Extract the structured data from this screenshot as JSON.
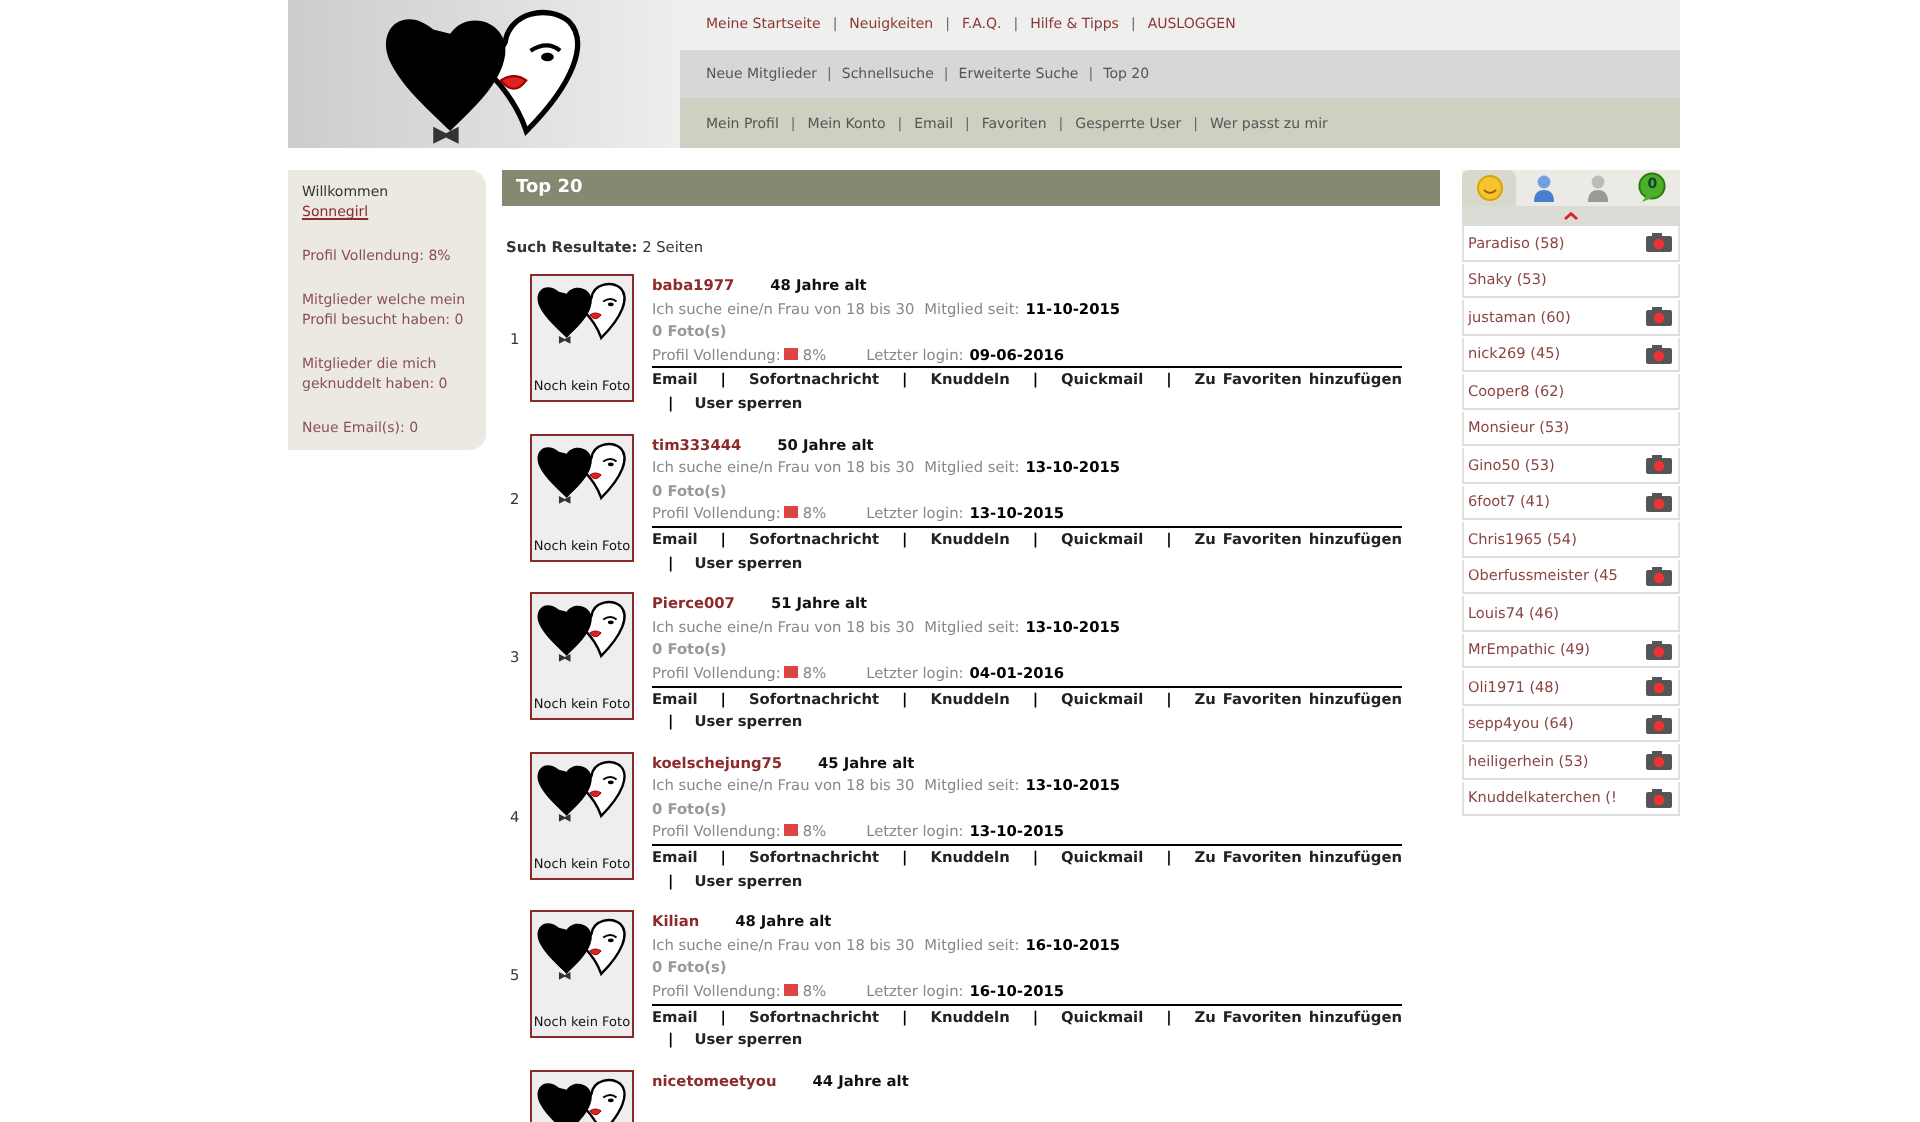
{
  "separator": "|",
  "header": {
    "nav_top": [
      "Meine Startseite",
      "Neuigkeiten",
      "F.A.Q.",
      "Hilfe & Tipps",
      "AUSLOGGEN"
    ],
    "nav_middle": [
      "Neue Mitglieder",
      "Schnellsuche",
      "Erweiterte Suche",
      "Top 20"
    ],
    "nav_bottom": [
      "Mein Profil",
      "Mein Konto",
      "Email",
      "Favoriten",
      "Gesperrte User",
      "Wer passt zu mir"
    ]
  },
  "left_panel": {
    "greeting": "Willkommen",
    "username": "Sonnegirl",
    "stats": [
      "Profil Vollendung: 8%",
      "Mitglieder welche mein Profil besucht haben: 0",
      "Mitglieder die mich geknuddelt haben: 0",
      "Neue Email(s): 0"
    ]
  },
  "main": {
    "title": "Top 20",
    "results_label": "Such Resultate:",
    "results_value": "2 Seiten",
    "results": [
      {
        "rank": "1",
        "name": "baba1977",
        "age": "48 Jahre alt",
        "search": "Ich suche eine/n Frau von 18 bis 30",
        "since_label": "Mitglied seit:",
        "since": "11-10-2015",
        "photos": "0 Foto(s)",
        "photo_text": "Noch kein Foto",
        "completion_label": "Profil Vollendung:",
        "completion": "8%",
        "login_label": "Letzter login:",
        "login": "09-06-2016",
        "actions": [
          "Email",
          "Sofortnachricht",
          "Knuddeln",
          "Quickmail",
          "Zu Favoriten hinzufügen",
          "User sperren"
        ]
      },
      {
        "rank": "2",
        "name": "tim333444",
        "age": "50 Jahre alt",
        "search": "Ich suche eine/n Frau von 18 bis 30",
        "since_label": "Mitglied seit:",
        "since": "13-10-2015",
        "photos": "0 Foto(s)",
        "photo_text": "Noch kein Foto",
        "completion_label": "Profil Vollendung:",
        "completion": "8%",
        "login_label": "Letzter login:",
        "login": "13-10-2015",
        "actions": [
          "Email",
          "Sofortnachricht",
          "Knuddeln",
          "Quickmail",
          "Zu Favoriten hinzufügen",
          "User sperren"
        ]
      },
      {
        "rank": "3",
        "name": "Pierce007",
        "age": "51 Jahre alt",
        "search": "Ich suche eine/n Frau von 18 bis 30",
        "since_label": "Mitglied seit:",
        "since": "13-10-2015",
        "photos": "0 Foto(s)",
        "photo_text": "Noch kein Foto",
        "completion_label": "Profil Vollendung:",
        "completion": "8%",
        "login_label": "Letzter login:",
        "login": "04-01-2016",
        "actions": [
          "Email",
          "Sofortnachricht",
          "Knuddeln",
          "Quickmail",
          "Zu Favoriten hinzufügen",
          "User sperren"
        ]
      },
      {
        "rank": "4",
        "name": "koelschejung75",
        "age": "45 Jahre alt",
        "search": "Ich suche eine/n Frau von 18 bis 30",
        "since_label": "Mitglied seit:",
        "since": "13-10-2015",
        "photos": "0 Foto(s)",
        "photo_text": "Noch kein Foto",
        "completion_label": "Profil Vollendung:",
        "completion": "8%",
        "login_label": "Letzter login:",
        "login": "13-10-2015",
        "actions": [
          "Email",
          "Sofortnachricht",
          "Knuddeln",
          "Quickmail",
          "Zu Favoriten hinzufügen",
          "User sperren"
        ]
      },
      {
        "rank": "5",
        "name": "Kilian",
        "age": "48 Jahre alt",
        "search": "Ich suche eine/n Frau von 18 bis 30",
        "since_label": "Mitglied seit:",
        "since": "16-10-2015",
        "photos": "0 Foto(s)",
        "photo_text": "Noch kein Foto",
        "completion_label": "Profil Vollendung:",
        "completion": "8%",
        "login_label": "Letzter login:",
        "login": "16-10-2015",
        "actions": [
          "Email",
          "Sofortnachricht",
          "Knuddeln",
          "Quickmail",
          "Zu Favoriten hinzufügen",
          "User sperren"
        ]
      },
      {
        "name": "nicetomeetyou",
        "age": "44 Jahre alt"
      }
    ]
  },
  "online": {
    "tabs": [
      {
        "kind": "smiley",
        "selected": true
      },
      {
        "kind": "user-blue",
        "selected": false
      },
      {
        "kind": "user-grey",
        "selected": false
      },
      {
        "kind": "chat",
        "badge": "0",
        "selected": false
      }
    ],
    "users": [
      {
        "label": "Paradiso (58)",
        "webcam": true
      },
      {
        "label": "Shaky (53)",
        "webcam": false
      },
      {
        "label": "justaman (60)",
        "webcam": true
      },
      {
        "label": "nick269 (45)",
        "webcam": true
      },
      {
        "label": "Cooper8 (62)",
        "webcam": false
      },
      {
        "label": "Monsieur (53)",
        "webcam": false
      },
      {
        "label": "Gino50 (53)",
        "webcam": true
      },
      {
        "label": "6foot7 (41)",
        "webcam": true
      },
      {
        "label": "Chris1965 (54)",
        "webcam": false
      },
      {
        "label": "Oberfussmeister (45",
        "webcam": true
      },
      {
        "label": "Louis74 (46)",
        "webcam": false
      },
      {
        "label": "MrEmpathic (49)",
        "webcam": true
      },
      {
        "label": "Oli1971 (48)",
        "webcam": true
      },
      {
        "label": "sepp4you (64)",
        "webcam": true
      },
      {
        "label": "heiligerhein (53)",
        "webcam": true
      },
      {
        "label": "Knuddelkaterchen (!",
        "webcam": true
      }
    ]
  }
}
